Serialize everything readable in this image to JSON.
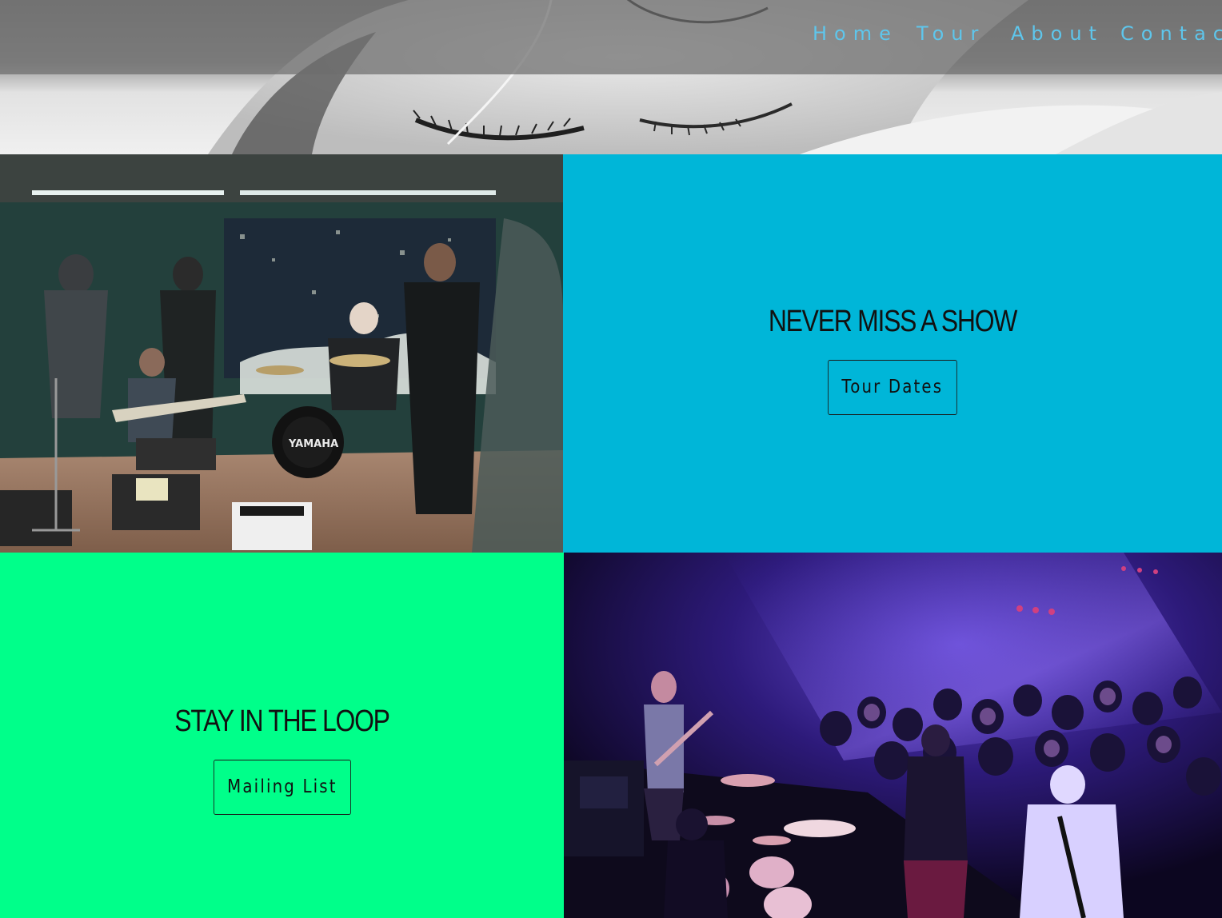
{
  "nav": {
    "items": [
      {
        "label": "Home"
      },
      {
        "label": "Tour"
      },
      {
        "label": "About"
      },
      {
        "label": "Contact"
      }
    ]
  },
  "tour_promo": {
    "heading": "NEVER MISS A SHOW",
    "button_label": "Tour Dates"
  },
  "mailing_promo": {
    "heading": "STAY IN THE LOOP",
    "button_label": "Mailing List"
  },
  "colors": {
    "nav_link": "#5ec6ec",
    "tour_panel": "#00b6d8",
    "mailing_panel": "#00ff8a"
  }
}
